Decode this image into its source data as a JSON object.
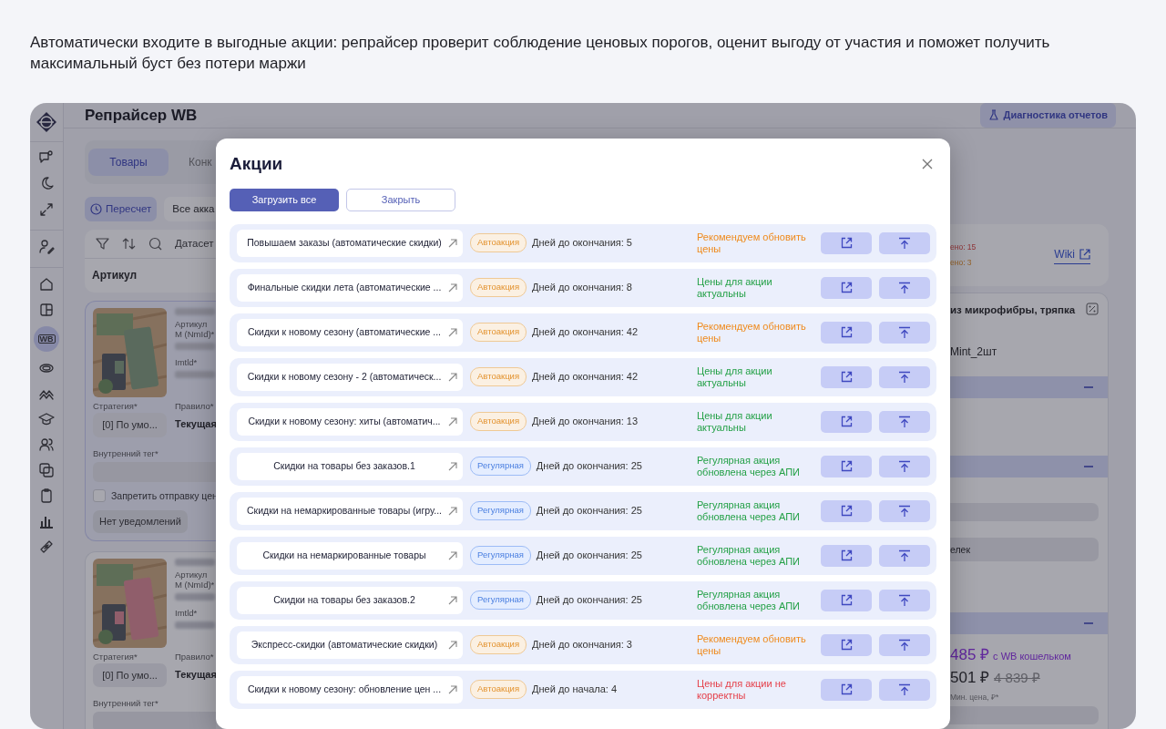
{
  "caption": "Автоматически входите в выгодные акции: репрайсер проверит соблюдение ценовых порогов, оценит выгоду от участия и поможет получить максимальный буст без потери маржи",
  "app": {
    "title": "Репрайсер WB",
    "diagnostics_button": "Диагностика отчетов",
    "sidebar": {
      "tools": [
        {
          "kind": "chat"
        },
        {
          "kind": "moon"
        },
        {
          "kind": "expand"
        }
      ],
      "account": [
        {
          "kind": "user-edit"
        }
      ],
      "nav": [
        {
          "kind": "home",
          "selected": false
        },
        {
          "kind": "layout",
          "selected": false
        },
        {
          "kind": "wb",
          "label": "WB",
          "selected": true
        },
        {
          "kind": "rings",
          "selected": false
        },
        {
          "kind": "waves",
          "selected": false
        },
        {
          "kind": "cap",
          "selected": false
        },
        {
          "kind": "users",
          "selected": false
        },
        {
          "kind": "copy",
          "selected": false
        },
        {
          "kind": "clipboard",
          "selected": false
        },
        {
          "kind": "bars",
          "selected": false
        },
        {
          "kind": "link",
          "selected": false
        }
      ]
    },
    "tabs": [
      {
        "label": "Товары",
        "selected": true
      },
      {
        "label": "Конк",
        "selected": false
      }
    ],
    "recalc_button": "Пересчет",
    "account_select": "Все акка",
    "dataset_label": "Датасет",
    "column_header": "Артикул",
    "products": [
      {
        "article_label": "Артикул М (NmId)*",
        "imt_label": "Imtld*",
        "strategy_label": "Стратегия*",
        "strategy_value": "[0] По умо...",
        "rule_label": "Правило*",
        "rule_value": "Текущая",
        "tag_label": "Внутренний тег*",
        "forbid_label": "Запретить отправку цен",
        "forbid_checked": false,
        "notifications_button": "Нет уведомлений",
        "selected": true
      },
      {
        "article_label": "Артикул М (NmId)*",
        "imt_label": "Imtld*",
        "strategy_label": "Стратегия*",
        "strategy_value": "[0] По умо...",
        "rule_label": "Правило*",
        "rule_value": "Текущая",
        "tag_label": "Внутренний тег*",
        "selected": false
      }
    ],
    "stats": [
      {
        "text": "ено: 15",
        "kind": "error"
      },
      {
        "text": "ено: 3",
        "kind": "warning"
      }
    ],
    "wiki_link": "Wiki",
    "product_title": "из микрофибры, тряпка",
    "vendor_code": "Mint_2шт",
    "field_value": "елек",
    "wallet_price": "485 ₽",
    "wallet_note": "с WB кошельком",
    "price": "501 ₽",
    "old_price": "4 839 ₽",
    "min_price_label": "Мин. цена, ₽*"
  },
  "modal": {
    "title": "Акции",
    "load_all_button": "Загрузить все",
    "close_button": "Закрыть",
    "promos": [
      {
        "name": "Повышаем заказы (автоматические скидки)",
        "badge": {
          "text": "Автоакция",
          "kind": "auto"
        },
        "days": "Дней до окончания: 5",
        "status": {
          "text": "Рекомендуем обновить цены",
          "kind": "warning"
        }
      },
      {
        "name": "Финальные скидки лета (автоматические ...",
        "badge": {
          "text": "Автоакция",
          "kind": "auto"
        },
        "days": "Дней до окончания: 8",
        "status": {
          "text": "Цены для акции актуальны",
          "kind": "ok"
        }
      },
      {
        "name": "Скидки к новому сезону (автоматические ...",
        "badge": {
          "text": "Автоакция",
          "kind": "auto"
        },
        "days": "Дней до окончания: 42",
        "status": {
          "text": "Рекомендуем обновить цены",
          "kind": "warning"
        }
      },
      {
        "name": "Скидки к новому сезону - 2 (автоматическ...",
        "badge": {
          "text": "Автоакция",
          "kind": "auto"
        },
        "days": "Дней до окончания: 42",
        "status": {
          "text": "Цены для акции актуальны",
          "kind": "ok"
        }
      },
      {
        "name": "Скидки к новому сезону: хиты (автоматич...",
        "badge": {
          "text": "Автоакция",
          "kind": "auto"
        },
        "days": "Дней до окончания: 13",
        "status": {
          "text": "Цены для акции актуальны",
          "kind": "ok"
        }
      },
      {
        "name": "Скидки на товары без заказов.1",
        "badge": {
          "text": "Регулярная",
          "kind": "regular"
        },
        "days": "Дней до окончания: 25",
        "status": {
          "text": "Регулярная акция обновлена через АПИ",
          "kind": "ok"
        }
      },
      {
        "name": "Скидки на немаркированные товары (игру...",
        "badge": {
          "text": "Регулярная",
          "kind": "regular"
        },
        "days": "Дней до окончания: 25",
        "status": {
          "text": "Регулярная акция обновлена через АПИ",
          "kind": "ok"
        }
      },
      {
        "name": "Скидки на немаркированные товары",
        "badge": {
          "text": "Регулярная",
          "kind": "regular"
        },
        "days": "Дней до окончания: 25",
        "status": {
          "text": "Регулярная акция обновлена через АПИ",
          "kind": "ok"
        }
      },
      {
        "name": "Скидки на товары без заказов.2",
        "badge": {
          "text": "Регулярная",
          "kind": "regular"
        },
        "days": "Дней до окончания: 25",
        "status": {
          "text": "Регулярная акция обновлена через АПИ",
          "kind": "ok"
        }
      },
      {
        "name": "Экспресс-скидки (автоматические скидки)",
        "badge": {
          "text": "Автоакция",
          "kind": "auto"
        },
        "days": "Дней до окончания: 3",
        "status": {
          "text": "Рекомендуем обновить цены",
          "kind": "warning"
        }
      },
      {
        "name": "Скидки к новому сезону: обновление цен ...",
        "badge": {
          "text": "Автоакция",
          "kind": "auto"
        },
        "days": "Дней до начала: 4",
        "status": {
          "text": "Цены для акции не корректны",
          "kind": "error"
        }
      }
    ]
  }
}
